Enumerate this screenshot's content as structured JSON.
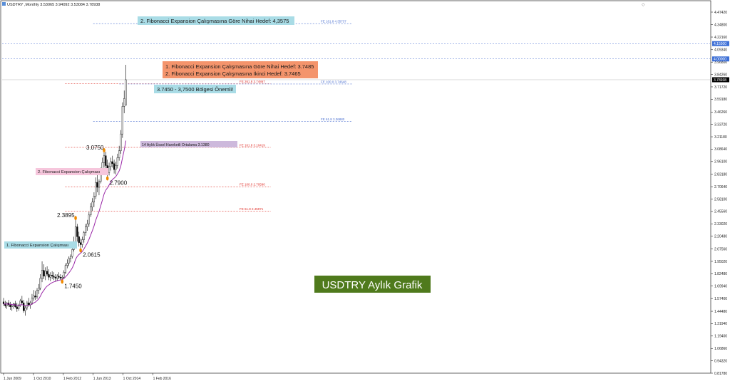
{
  "header": {
    "title": "USDTRY ,Monthly  3.53065 3.94092 3.53084 3.78938"
  },
  "price_tag": {
    "label": "3.78938",
    "value": 3.78938
  },
  "level_tags": [
    {
      "label": "4.15500",
      "value": 4.155
    },
    {
      "label": "4.00000",
      "value": 4.0
    }
  ],
  "chart_data": {
    "type": "candlestick",
    "title": "USDTRY Aylık Grafik",
    "xlabel": "",
    "ylabel": "",
    "ylim": [
      0.8178,
      4.4742
    ],
    "y_ticks": [
      "4.47420",
      "4.34800",
      "4.22160",
      "4.09340",
      "3.96800",
      "3.84260",
      "3.71720",
      "3.59180",
      "3.46260",
      "3.33720",
      "3.21180",
      "3.08640",
      "2.96100",
      "2.83180",
      "2.70640",
      "2.58100",
      "2.45560",
      "2.33020",
      "2.20480",
      "2.07560",
      "1.95020",
      "1.82480",
      "1.69940",
      "1.57400",
      "1.44480",
      "1.31940",
      "1.19400",
      "1.06860",
      "0.94320",
      "0.81780"
    ],
    "x_ticks": [
      "1 Jun 2009",
      "1 Oct 2010",
      "1 Feb 2012",
      "1 Jun 2013",
      "1 Oct 2014",
      "1 Feb 2016"
    ],
    "x_tick_index": [
      0,
      16,
      32,
      48,
      64,
      80
    ],
    "series": [
      {
        "name": "USDTRY",
        "ohlc": [
          [
            1.54,
            1.58,
            1.5,
            1.52
          ],
          [
            1.52,
            1.55,
            1.48,
            1.5
          ],
          [
            1.5,
            1.54,
            1.47,
            1.53
          ],
          [
            1.53,
            1.56,
            1.49,
            1.51
          ],
          [
            1.51,
            1.54,
            1.46,
            1.49
          ],
          [
            1.49,
            1.52,
            1.45,
            1.5
          ],
          [
            1.5,
            1.53,
            1.47,
            1.52
          ],
          [
            1.52,
            1.55,
            1.48,
            1.49
          ],
          [
            1.49,
            1.53,
            1.44,
            1.47
          ],
          [
            1.47,
            1.52,
            1.45,
            1.5
          ],
          [
            1.5,
            1.57,
            1.49,
            1.55
          ],
          [
            1.55,
            1.6,
            1.52,
            1.53
          ],
          [
            1.53,
            1.56,
            1.43,
            1.45
          ],
          [
            1.45,
            1.5,
            1.4,
            1.48
          ],
          [
            1.48,
            1.55,
            1.46,
            1.53
          ],
          [
            1.53,
            1.58,
            1.49,
            1.51
          ],
          [
            1.51,
            1.55,
            1.47,
            1.53
          ],
          [
            1.53,
            1.62,
            1.51,
            1.58
          ],
          [
            1.58,
            1.66,
            1.55,
            1.6
          ],
          [
            1.6,
            1.65,
            1.56,
            1.59
          ],
          [
            1.59,
            1.68,
            1.57,
            1.66
          ],
          [
            1.66,
            1.72,
            1.62,
            1.68
          ],
          [
            1.68,
            1.82,
            1.66,
            1.78
          ],
          [
            1.78,
            1.95,
            1.74,
            1.86
          ],
          [
            1.86,
            1.92,
            1.77,
            1.8
          ],
          [
            1.8,
            1.89,
            1.76,
            1.85
          ],
          [
            1.85,
            1.9,
            1.8,
            1.82
          ],
          [
            1.82,
            1.87,
            1.76,
            1.79
          ],
          [
            1.79,
            1.84,
            1.75,
            1.81
          ],
          [
            1.81,
            1.85,
            1.77,
            1.8
          ],
          [
            1.8,
            1.84,
            1.76,
            1.79
          ],
          [
            1.79,
            1.82,
            1.75,
            1.78
          ],
          [
            1.78,
            1.82,
            1.75,
            1.8
          ],
          [
            1.8,
            1.84,
            1.77,
            1.79
          ],
          [
            1.79,
            1.82,
            1.76,
            1.78
          ],
          [
            1.78,
            1.81,
            1.745,
            1.79
          ],
          [
            1.79,
            1.86,
            1.77,
            1.84
          ],
          [
            1.84,
            1.93,
            1.82,
            1.91
          ],
          [
            1.91,
            1.97,
            1.88,
            1.93
          ],
          [
            1.93,
            2.0,
            1.9,
            1.98
          ],
          [
            1.98,
            2.02,
            1.94,
            2.0
          ],
          [
            2.0,
            2.1,
            1.98,
            2.07
          ],
          [
            2.07,
            2.2,
            2.05,
            2.15
          ],
          [
            2.15,
            2.3895,
            2.12,
            2.3
          ],
          [
            2.3,
            2.33,
            2.15,
            2.2
          ],
          [
            2.2,
            2.25,
            2.1,
            2.14
          ],
          [
            2.14,
            2.18,
            2.0615,
            2.12
          ],
          [
            2.12,
            2.2,
            2.09,
            2.17
          ],
          [
            2.17,
            2.26,
            2.14,
            2.24
          ],
          [
            2.24,
            2.33,
            2.21,
            2.3
          ],
          [
            2.3,
            2.37,
            2.26,
            2.33
          ],
          [
            2.33,
            2.45,
            2.3,
            2.42
          ],
          [
            2.42,
            2.54,
            2.4,
            2.5
          ],
          [
            2.5,
            2.59,
            2.46,
            2.55
          ],
          [
            2.55,
            2.65,
            2.5,
            2.61
          ],
          [
            2.61,
            2.8,
            2.58,
            2.75
          ],
          [
            2.75,
            2.83,
            2.65,
            2.7
          ],
          [
            2.7,
            2.78,
            2.62,
            2.76
          ],
          [
            2.76,
            2.9,
            2.74,
            2.88
          ],
          [
            2.88,
            3.0,
            2.85,
            2.95
          ],
          [
            2.95,
            3.075,
            2.9,
            3.02
          ],
          [
            3.02,
            3.06,
            2.88,
            2.92
          ],
          [
            2.92,
            2.98,
            2.79,
            2.85
          ],
          [
            2.85,
            2.95,
            2.82,
            2.91
          ],
          [
            2.91,
            3.0,
            2.87,
            2.96
          ],
          [
            2.96,
            3.02,
            2.9,
            2.94
          ],
          [
            2.94,
            2.98,
            2.84,
            2.88
          ],
          [
            2.88,
            2.96,
            2.83,
            2.92
          ],
          [
            2.92,
            3.04,
            2.89,
            3.0
          ],
          [
            3.0,
            3.12,
            2.97,
            3.07
          ],
          [
            3.07,
            3.28,
            3.04,
            3.24
          ],
          [
            3.24,
            3.56,
            3.2,
            3.52
          ],
          [
            3.52,
            3.68,
            3.45,
            3.6
          ],
          [
            3.53065,
            3.94092,
            3.53084,
            3.78938
          ]
        ]
      },
      {
        "name": "14 Aylık Üssel Hareketli Ortalama 3.1380",
        "type": "ema"
      }
    ],
    "fib_levels": [
      {
        "label": "FE 161.8 4.35737",
        "value": 4.35737,
        "color": "#4a6fd0",
        "x_from": 48,
        "x_to": 82
      },
      {
        "label": "FE 261.8 3.74867",
        "value": 3.74867,
        "color": "#e0302a",
        "x_from": 33,
        "x_to": 60
      },
      {
        "label": "FE 100.0 3.74648",
        "value": 3.74648,
        "color": "#4a6fd0",
        "x_from": 62,
        "x_to": 82
      },
      {
        "label": "FE 61.8 3.36880",
        "value": 3.3688,
        "color": "#4a6fd0",
        "x_from": 48,
        "x_to": 82
      },
      {
        "label": "FE 161.8 3.10419",
        "value": 3.10419,
        "color": "#e0302a",
        "x_from": 33,
        "x_to": 62
      },
      {
        "label": "FE 100.0 2.70590",
        "value": 2.7059,
        "color": "#e0302a",
        "x_from": 33,
        "x_to": 62
      },
      {
        "label": "FE 61.8 2.45971",
        "value": 2.45971,
        "color": "#e0302a",
        "x_from": 33,
        "x_to": 62
      }
    ],
    "h_lines": [
      {
        "value": 4.155,
        "color": "#4a6fd0"
      },
      {
        "value": 4.0,
        "color": "#4a6fd0"
      }
    ],
    "points": [
      {
        "label": "1.7450",
        "x": 35,
        "y": 1.745
      },
      {
        "label": "2.3895",
        "x": 43,
        "y": 2.3895
      },
      {
        "label": "2.0615",
        "x": 46,
        "y": 2.0615
      },
      {
        "label": "3.0750",
        "x": 60,
        "y": 3.075
      },
      {
        "label": "2.7900",
        "x": 62,
        "y": 2.79
      }
    ]
  },
  "annotations": {
    "target_2": "2. Fibonacci Expansion Çalışmasına Göre Nihai Hedef: 4,3575",
    "target_1_line1": "1. Fibonacci Expansion Çalışmasına Göre Nihai Hedef: 3.7485",
    "target_1_line2": "2. Fibonacci Expansion Çalışmasına İkinci Hedef: 3.7465",
    "zone": "3.7450 - 3,7500 Bölgesi Önemli!",
    "ema_label": "14 Aylık Üssel Hareketli Ortalama 3.1380",
    "fib_work_2": "2. Fibonacci Expansion Çalışması",
    "fib_work_1": "1. Fibonacci Expansion Çalışması",
    "big_title": "USDTRY Aylık Grafik"
  },
  "colors": {
    "ema": "#9b2aa8",
    "candle": "#000000",
    "box_cyan": "#a9dce6",
    "box_orange": "#f4946c",
    "box_pink": "#f6c6dc",
    "box_lavender": "#cdb9dc",
    "box_green": "#4f7a1c",
    "marker": "#f08a00"
  }
}
